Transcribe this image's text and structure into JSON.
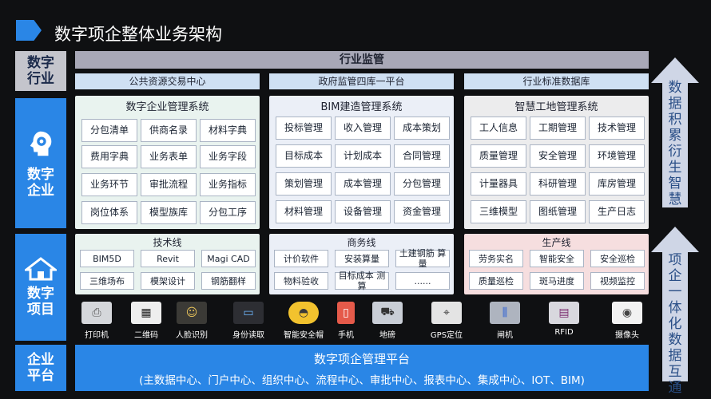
{
  "title": "数字项企整体业务架构",
  "sides": {
    "l1": "数字",
    "l2": "行业",
    "e1": "数字",
    "e2": "企业",
    "p1": "数字",
    "p2": "项目",
    "q1": "企业",
    "q2": "平台"
  },
  "top_bar": "行业监管",
  "subs": [
    "公共资源交易中心",
    "政府监管四库一平台",
    "行业标准数据库"
  ],
  "panels": [
    {
      "title": "数字企业管理系统",
      "items": [
        "分包清单",
        "供商名录",
        "材料字典",
        "费用字典",
        "业务表单",
        "业务字段",
        "业务环节",
        "审批流程",
        "业务指标",
        "岗位体系",
        "模型族库",
        "分包工序"
      ]
    },
    {
      "title": "BIM建造管理系统",
      "items": [
        "投标管理",
        "收入管理",
        "成本策划",
        "目标成本",
        "计划成本",
        "合同管理",
        "策划管理",
        "成本管理",
        "分包管理",
        "材料管理",
        "设备管理",
        "资金管理"
      ]
    },
    {
      "title": "智慧工地管理系统",
      "items": [
        "工人信息",
        "工期管理",
        "技术管理",
        "质量管理",
        "安全管理",
        "环境管理",
        "计量器具",
        "科研管理",
        "库房管理",
        "三维模型",
        "图纸管理",
        "生产日志"
      ]
    }
  ],
  "lines": [
    {
      "title": "技术线",
      "items": [
        "BIM5D",
        "Revit",
        "Magi CAD",
        "三维场布",
        "模架设计",
        "钢筋翻样"
      ]
    },
    {
      "title": "商务线",
      "items": [
        "计价软件",
        "安装算量",
        "土建钢筋 算量",
        "物料验收",
        "目标成本 测算",
        "......"
      ]
    },
    {
      "title": "生产线",
      "items": [
        "劳务实名",
        "智能安全",
        "安全巡检",
        "质量巡检",
        "斑马进度",
        "视频监控"
      ]
    }
  ],
  "devices": [
    {
      "label": "打印机",
      "icon": "printer-icon",
      "glyph": "⎙"
    },
    {
      "label": "二维码",
      "icon": "qrcode-icon",
      "glyph": "▦"
    },
    {
      "label": "人脸识别",
      "icon": "face-recognition-icon",
      "glyph": "☺"
    },
    {
      "label": "身份读取",
      "icon": "id-reader-icon",
      "glyph": "▭"
    },
    {
      "label": "智能安全帽",
      "icon": "helmet-icon",
      "glyph": "◓"
    },
    {
      "label": "手机",
      "icon": "phone-icon",
      "glyph": "▯"
    },
    {
      "label": "地磅",
      "icon": "truck-scale-icon",
      "glyph": "⛟"
    },
    {
      "label": "GPS定位",
      "icon": "gps-icon",
      "glyph": "⌖"
    },
    {
      "label": "闸机",
      "icon": "gate-icon",
      "glyph": "⫼"
    },
    {
      "label": "RFID",
      "icon": "rfid-icon",
      "glyph": "▤"
    },
    {
      "label": "摄像头",
      "icon": "camera-icon",
      "glyph": "◉"
    }
  ],
  "platform": {
    "line1": "数字项企管理平台",
    "line2": "(主数据中心、门户中心、组织中心、流程中心、审批中心、报表中心、集成中心、IOT、BIM)"
  },
  "right": {
    "up_text": "数据积累衍生智慧",
    "down_text": "项企一体化数据互通"
  }
}
